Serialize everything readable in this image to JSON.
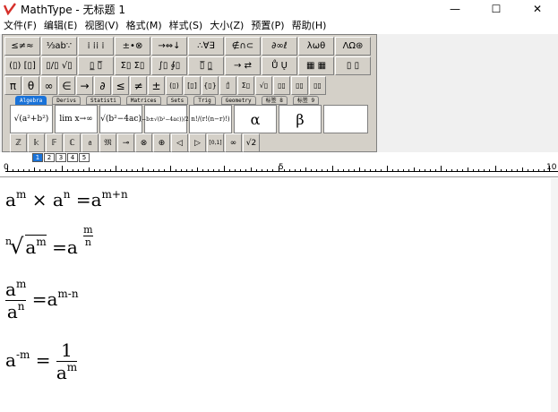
{
  "window": {
    "title": "MathType - 无标题 1",
    "controls": {
      "minimize": "—",
      "maximize": "☐",
      "close": "✕"
    }
  },
  "menu": [
    "文件(F)",
    "编辑(E)",
    "视图(V)",
    "格式(M)",
    "样式(S)",
    "大小(Z)",
    "预置(P)",
    "帮助(H)"
  ],
  "toolbar": {
    "row1": [
      "≤≠≈",
      "⅓ab∵",
      "⁞ ⁞⁞ ⁞",
      "±•⊗",
      "→⇔↓",
      "∴∀∃",
      "∉∩⊂",
      "∂∞ℓ",
      "λωθ",
      "ΛΩ⊛"
    ],
    "row2": [
      "(▯) [▯]",
      "▯/▯ √▯",
      "▯̲ ▯̅",
      "Σ▯ Σ▯",
      "∫▯ ∮▯",
      "▯̅ ▯̲",
      "→ ⇄",
      "Ů Ų",
      "▦ ▦",
      "▯ ▯"
    ],
    "row3": [
      "π",
      "θ",
      "∞",
      "∈",
      "→",
      "∂",
      "≤",
      "≠",
      "±",
      "(▯)",
      "[▯]",
      "{▯}",
      "▯̂",
      "Σ▯",
      "√▯",
      "▯▯",
      "▯▯",
      "▯▯"
    ],
    "tabs": [
      "Algebra",
      "Derivs",
      "Statisti",
      "Matrices",
      "Sets",
      "Trig",
      "Geometry",
      "标签 8",
      "标签 9"
    ],
    "templates": [
      "√(a²+b²)",
      "lim x→∞",
      "√(b²−4ac)",
      "(−b±√(b²−4ac))/2a",
      "n!/(r!(n−r)!)",
      "α",
      "β",
      ""
    ],
    "row5": [
      "ℤ",
      "𝕜",
      "𝔽",
      "ℂ",
      "𝔞",
      "𝔐",
      "⊸",
      "⊗",
      "⊕",
      "◁",
      "▷",
      "[0,1]",
      "∞",
      "√2"
    ],
    "small_buttons": [
      "1",
      "2",
      "3",
      "4",
      "5"
    ]
  },
  "ruler": {
    "marks": [
      "0",
      "5",
      "10"
    ]
  },
  "equations": [
    {
      "id": "eq1",
      "parts": [
        "a",
        "m",
        "×",
        "a",
        "n",
        "=",
        "a",
        "m+n"
      ]
    },
    {
      "id": "eq2",
      "parts": [
        "n",
        "a",
        "m",
        "=",
        "a",
        "m",
        "n"
      ]
    },
    {
      "id": "eq3",
      "parts": [
        "a",
        "m",
        "a",
        "n",
        "=",
        "a",
        "m-n"
      ]
    },
    {
      "id": "eq4",
      "parts": [
        "a",
        "-m",
        "=",
        "1",
        "a",
        "m"
      ]
    }
  ],
  "colors": {
    "accent": "#1a73d9",
    "panel": "#d4d0c8",
    "logo_red": "#d6302a"
  }
}
